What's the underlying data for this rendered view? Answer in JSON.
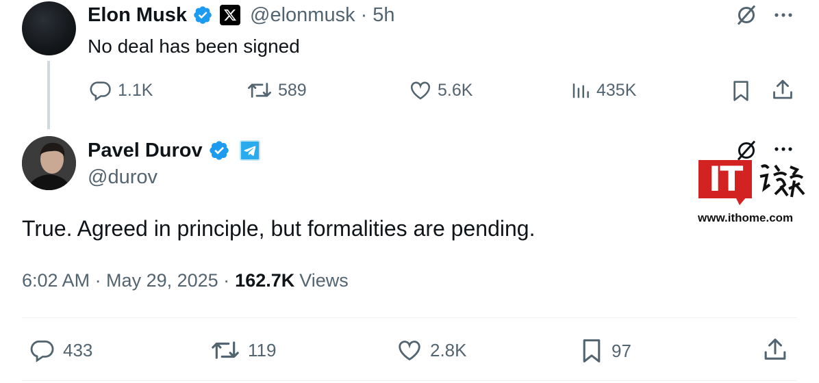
{
  "tweet1": {
    "name": "Elon Musk",
    "handle": "@elonmusk",
    "separator": "·",
    "time": "5h",
    "text": "No deal has been signed",
    "affiliate_badge": "x-logo-icon",
    "actions": {
      "replies": "1.1K",
      "reposts": "589",
      "likes": "5.6K",
      "views": "435K"
    }
  },
  "tweet2": {
    "name": "Pavel Durov",
    "handle": "@durov",
    "affiliate_badge": "telegram-icon",
    "text": "True. Agreed in principle, but formalities are pending.",
    "timestamp": "6:02 AM · May 29, 2025 ·",
    "views_count": "162.7K",
    "views_label": "Views",
    "actions": {
      "replies": "433",
      "reposts": "119",
      "likes": "2.8K",
      "bookmarks": "97"
    }
  },
  "watermark": {
    "logo_text": "IT",
    "domain": "www.ithome.com"
  },
  "colors": {
    "verified": "#1d9bf0",
    "text": "#0f1419",
    "muted": "#536471",
    "telegram": "#2aabee",
    "ithome_red": "#d22222"
  }
}
